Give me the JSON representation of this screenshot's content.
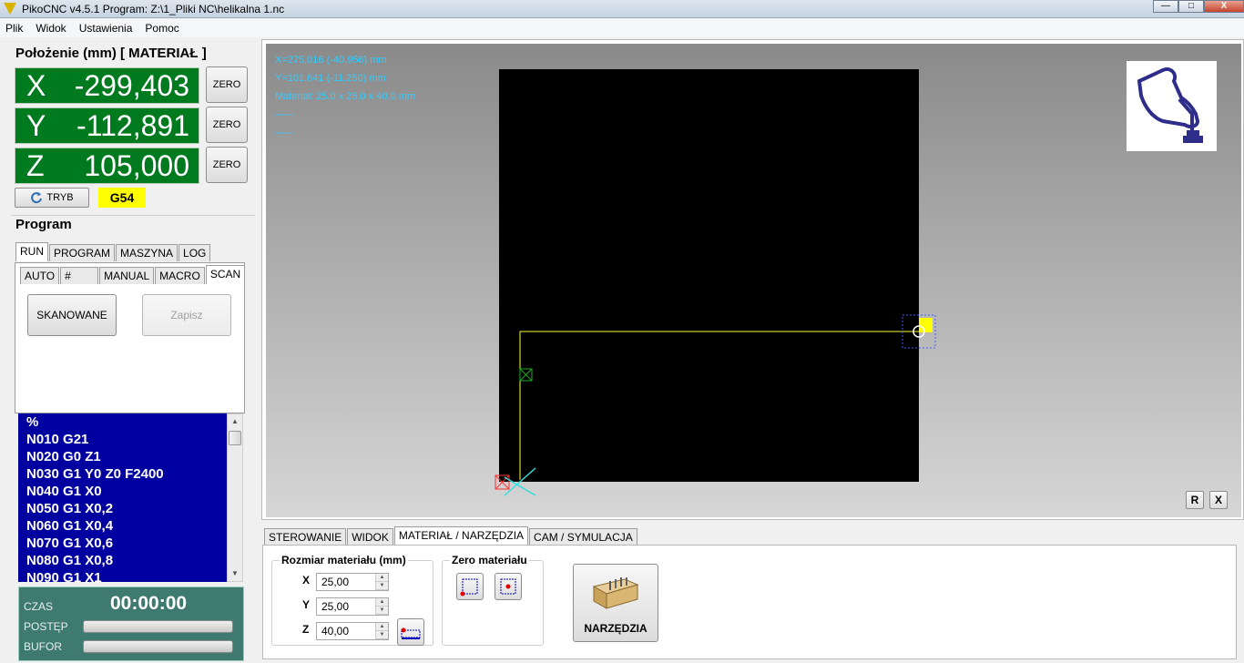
{
  "window": {
    "title": "PikoCNC v4.5.1    Program: Z:\\1_Pliki NC\\helikalna 1.nc",
    "minimize": "—",
    "maximize": "□",
    "close": "X"
  },
  "menu": [
    "Plik",
    "Widok",
    "Ustawienia",
    "Pomoc"
  ],
  "position": {
    "title": "Położenie (mm) [ MATERIAŁ ]",
    "axes": [
      {
        "label": "X",
        "value": "-299,403"
      },
      {
        "label": "Y",
        "value": "-112,891"
      },
      {
        "label": "Z",
        "value": "105,000"
      }
    ],
    "zero_label": "ZERO",
    "mode_label": "TRYB",
    "coord_system": "G54"
  },
  "program": {
    "title": "Program",
    "tabs": [
      "RUN",
      "PROGRAM",
      "MASZYNA",
      "LOG"
    ],
    "subtabs": [
      "AUTO",
      "#",
      "MANUAL",
      "MACRO",
      "SCAN"
    ],
    "scan_button": "SKANOWANE",
    "save_button": "Zapisz",
    "gcode_lines": [
      "%",
      "N010 G21",
      "N020 G0 Z1",
      "N030 G1 Y0 Z0 F2400",
      "N040 G1 X0",
      "N050 G1 X0,2",
      "N060 G1 X0,4",
      "N070 G1 X0,6",
      "N080 G1 X0,8",
      "N090 G1 X1"
    ],
    "status": {
      "time_label": "CZAS",
      "time_value": "00:00:00",
      "progress_label": "POSTĘP",
      "progress": 0,
      "buffer_label": "BUFOR",
      "buffer": 0
    }
  },
  "viewport": {
    "info_lines": [
      "X=275,016 (-40,956) mm",
      "Y=101,641 (-11,250) mm",
      "Materiał: 25,0 x 25,0 x 40,0 mm",
      "------",
      "------"
    ],
    "btn_r": "R",
    "btn_x": "X"
  },
  "bottom": {
    "tabs": [
      "STEROWANIE",
      "WIDOK",
      "MATERIAŁ / NARZĘDZIA",
      "CAM / SYMULACJA"
    ],
    "material_size_title": "Rozmiar materiału (mm)",
    "fields": [
      {
        "label": "X",
        "value": "25,00"
      },
      {
        "label": "Y",
        "value": "25,00"
      },
      {
        "label": "Z",
        "value": "40,00"
      }
    ],
    "zero_material_title": "Zero materiału",
    "tools_button": "NARZĘDZIA"
  },
  "colors": {
    "axis_bg": "#007a1e",
    "gcode_bg": "#0000a0",
    "coord_badge": "#ffff00",
    "info_text": "#33ccff",
    "status_bg": "#3e7a70"
  }
}
